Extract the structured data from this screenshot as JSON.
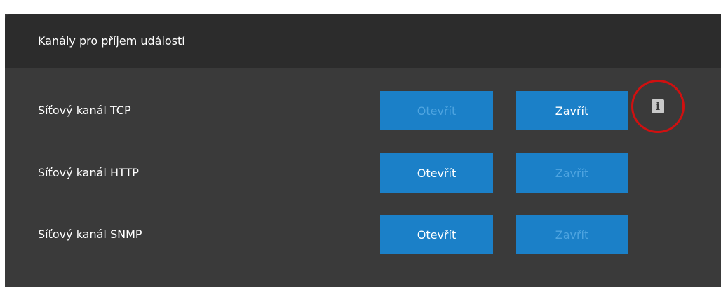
{
  "panel": {
    "title": "Kanály pro příjem událostí"
  },
  "rows": [
    {
      "label": "Síťový kanál TCP",
      "open_label": "Otevřít",
      "close_label": "Zavřít",
      "open_enabled": false,
      "close_enabled": true,
      "info_icon": "info-icon",
      "info_highlighted": true
    },
    {
      "label": "Síťový kanál HTTP",
      "open_label": "Otevřít",
      "close_label": "Zavřít",
      "open_enabled": true,
      "close_enabled": false
    },
    {
      "label": "Síťový kanál SNMP",
      "open_label": "Otevřít",
      "close_label": "Zavřít",
      "open_enabled": true,
      "close_enabled": false
    }
  ],
  "colors": {
    "panel_background": "#3a3a3a",
    "header_background": "#2c2c2c",
    "button_background": "#1b80c8",
    "disabled_button_text": "#4ea4e0",
    "highlight_circle": "#d01010"
  }
}
